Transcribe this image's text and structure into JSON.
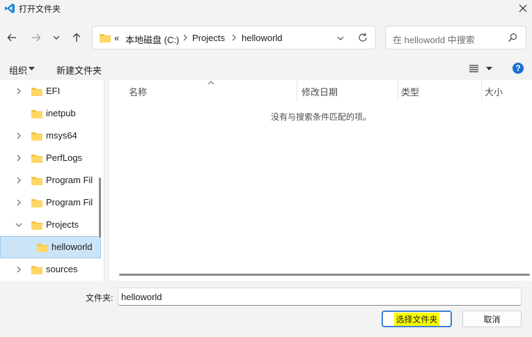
{
  "window": {
    "title": "打开文件夹"
  },
  "nav": {
    "address_crumbs": [
      "«",
      "本地磁盘 (C:)",
      "Projects",
      "helloworld"
    ],
    "search_placeholder": "在 helloworld 中搜索"
  },
  "toolbar": {
    "organize_label": "组织",
    "new_folder_label": "新建文件夹"
  },
  "tree": {
    "items": [
      {
        "label": "EFI",
        "expandable": true
      },
      {
        "label": "inetpub",
        "expandable": false
      },
      {
        "label": "msys64",
        "expandable": true
      },
      {
        "label": "PerfLogs",
        "expandable": true
      },
      {
        "label": "Program Fil",
        "expandable": true
      },
      {
        "label": "Program Fil",
        "expandable": true
      },
      {
        "label": "Projects",
        "expandable": true,
        "expanded": true
      },
      {
        "label": "helloworld",
        "expandable": false,
        "selected": true
      },
      {
        "label": "sources",
        "expandable": true
      }
    ]
  },
  "list": {
    "columns": [
      "名称",
      "修改日期",
      "类型",
      "大小"
    ],
    "empty_message": "没有与搜索条件匹配的项。"
  },
  "footer": {
    "folder_label": "文件夹:",
    "folder_value": "helloworld",
    "select_button": "选择文件夹",
    "cancel_button": "取消"
  },
  "colors": {
    "accent": "#3a7fd5",
    "selection": "#cce4f7",
    "highlight": "#ffff00",
    "folder": "#f5c343"
  }
}
